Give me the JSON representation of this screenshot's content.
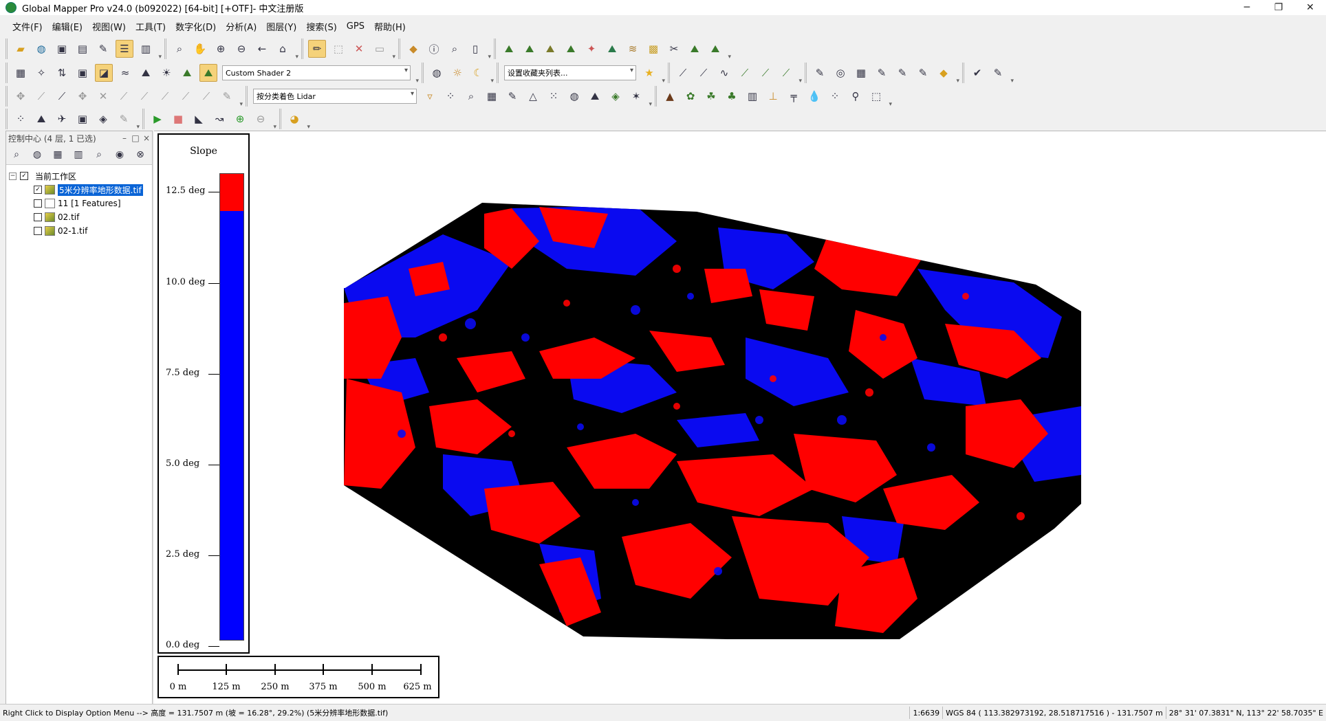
{
  "window": {
    "title": "Global Mapper Pro v24.0 (b092022) [64-bit] [+OTF]- 中文注册版",
    "minimize_icon": "minimize-icon",
    "restore_icon": "restore-icon",
    "close_icon": "close-icon"
  },
  "menu": [
    "文件(F)",
    "编辑(E)",
    "视图(W)",
    "工具(T)",
    "数字化(D)",
    "分析(A)",
    "图层(Y)",
    "搜索(S)",
    "GPS",
    "帮助(H)"
  ],
  "toolbar": {
    "shader_select": "Custom Shader 2",
    "favorites_select": "设置收藏夹列表...",
    "lidar_select": "按分类着色 Lidar"
  },
  "control_center": {
    "title": "控制中心 (4 层, 1 已选)",
    "root": "当前工作区",
    "layers": [
      {
        "name": "5米分辨率地形数据.tif",
        "checked": true,
        "selected": true
      },
      {
        "name": "11 [1 Features]",
        "checked": false,
        "selected": false
      },
      {
        "name": "02.tif",
        "checked": false,
        "selected": false
      },
      {
        "name": "02-1.tif",
        "checked": false,
        "selected": false
      }
    ]
  },
  "legend": {
    "title": "Slope",
    "labels": [
      "12.5 deg",
      "10.0 deg",
      "7.5 deg",
      "5.0 deg",
      "2.5 deg",
      "0.0 deg"
    ],
    "colors": {
      "high": "#ff0000",
      "low": "#0000ff"
    }
  },
  "scalebar": {
    "labels": [
      "0 m",
      "125 m",
      "250 m",
      "375 m",
      "500 m",
      "625 m"
    ]
  },
  "map": {
    "colors": {
      "steep": "#ff0000",
      "gentle": "#0000ff",
      "shadow": "#000000"
    }
  },
  "status": {
    "message": "Right Click to Display Option Menu --> 高度 = 131.7507 m (坡 = 16.28°, 29.2%) (5米分辨率地形数据.tif)",
    "scale": "1:6639",
    "coords": "WGS 84 ( 113.382973192, 28.518717516 ) - 131.7507 m",
    "dms": "28° 31' 07.3831\" N, 113° 22' 58.7035\" E"
  }
}
